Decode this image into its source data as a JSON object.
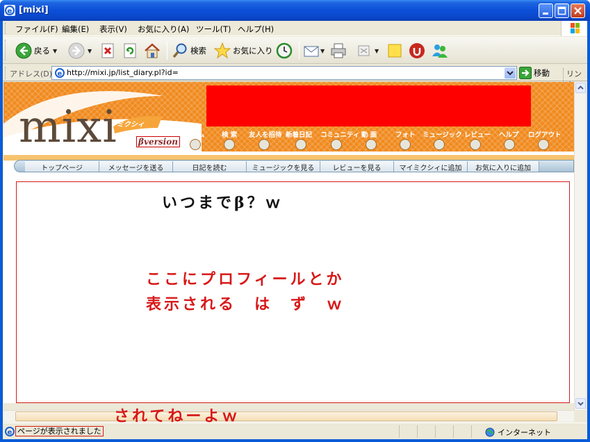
{
  "window": {
    "title": "[mixi]"
  },
  "menu": {
    "items": [
      "ファイル(F)",
      "編集(E)",
      "表示(V)",
      "お気に入り(A)",
      "ツール(T)",
      "ヘルプ(H)"
    ]
  },
  "toolbar": {
    "back_label": "戻る",
    "search_label": "検索",
    "favorites_label": "お気に入り"
  },
  "address": {
    "label": "アドレス(D)",
    "url": "http://mixi.jp/list_diary.pl?id=",
    "go_label": "移動",
    "links_label": "リンク"
  },
  "mixi": {
    "logo_text": "mixi",
    "logo_kana": "ミクシィ",
    "beta_label": "βversion",
    "banner_color": "#ff0000",
    "global_nav": [
      "ホーム",
      "検 索",
      "友人を招待",
      "新着日記",
      "コミュニティ",
      "動 画",
      "フォト",
      "ミュージック",
      "レビュー",
      "ヘルプ",
      "ログアウト"
    ],
    "sub_nav": [
      "トップページ",
      "メッセージを送る",
      "日記を読む",
      "ミュージックを見る",
      "レビューを見る",
      "マイミクシィに追加",
      "お気に入りに追加"
    ]
  },
  "annotations": {
    "beta_comment": "いつまでβ？ｗ",
    "profile_line1": "ここにプロフィールとか",
    "profile_line2": "表示される　は　ず　ｗ",
    "bottom_comment": "されてねーよｗ"
  },
  "status": {
    "text": "ページが表示されました",
    "zone": "インターネット"
  },
  "colors": {
    "header_orange": "#f08a1e",
    "annotation_red": "#d81818",
    "xp_blue": "#0a5bd9"
  }
}
